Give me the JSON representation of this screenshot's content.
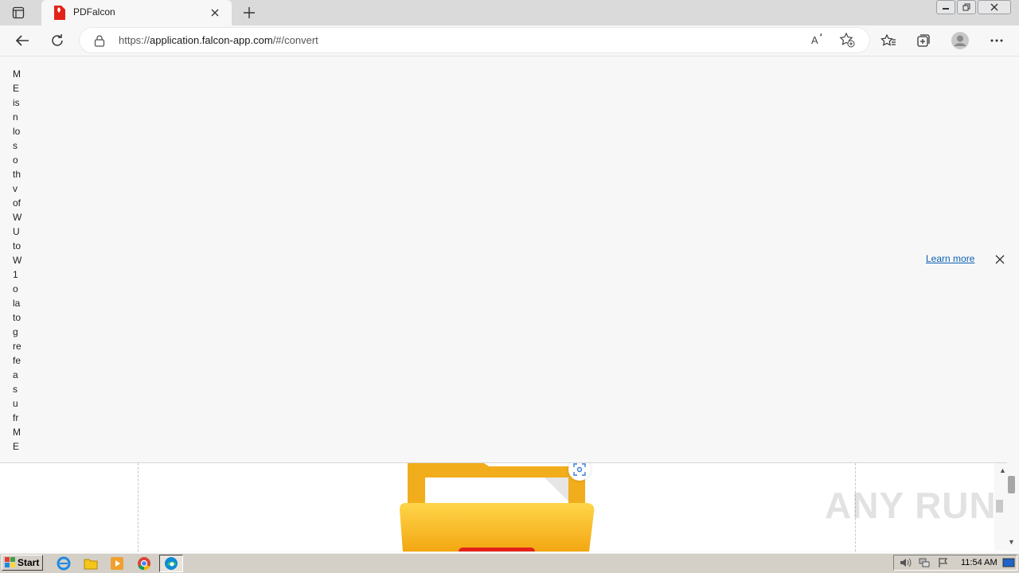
{
  "browser": {
    "tab": {
      "title": "PDFalcon",
      "favicon_text": "PDF"
    },
    "address": {
      "scheme": "https://",
      "host": "application.falcon-app.com",
      "path": "/#/convert"
    }
  },
  "page": {
    "vertical_text": [
      "M",
      "E",
      "is",
      "n",
      "lo",
      "s",
      "o",
      "th",
      "v",
      "of",
      "W",
      "U",
      "to",
      "W",
      "1",
      "o",
      "la",
      "to",
      "g",
      "re",
      "fe",
      "a",
      "s",
      "u",
      "fr",
      "M",
      "E"
    ],
    "banner": {
      "learn_more": "Learn more"
    },
    "watermark": "ANY RUN"
  },
  "taskbar": {
    "start_label": "Start",
    "clock": "11:54 AM",
    "pinned": [
      "internet-explorer-icon",
      "file-explorer-icon",
      "media-player-icon",
      "chrome-icon",
      "edge-icon"
    ]
  },
  "colors": {
    "tab_bar": "#dadada",
    "link": "#0e60b3",
    "folder_yellow": "#f5b51f",
    "pdf_red": "#e2231a"
  }
}
